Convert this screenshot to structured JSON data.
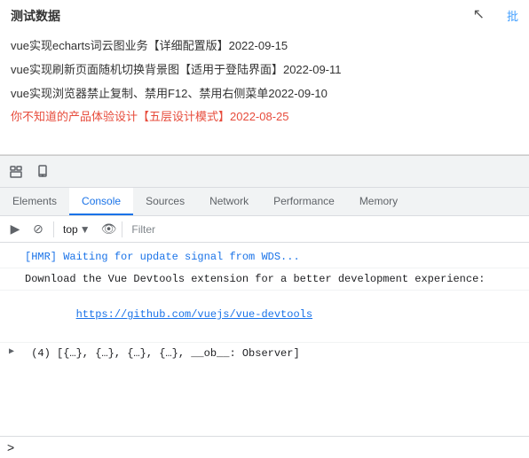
{
  "page": {
    "title": "测试数据",
    "batch_link": "批",
    "cursor_symbol": "↖"
  },
  "articles": [
    {
      "text": "vue实现echarts词云图业务【详细配置版】2022-09-15",
      "red": false
    },
    {
      "text": "vue实现刷新页面随机切换背景图【适用于登陆界面】2022-09-11",
      "red": false
    },
    {
      "text": "vue实现浏览器禁止复制、禁用F12、禁用右侧菜单2022-09-10",
      "red": false
    },
    {
      "text": "你不知道的产品体验设计【五层设计模式】2022-08-25",
      "red": true
    }
  ],
  "devtools": {
    "tabs": [
      {
        "label": "Elements",
        "active": false
      },
      {
        "label": "Console",
        "active": true
      },
      {
        "label": "Sources",
        "active": false
      },
      {
        "label": "Network",
        "active": false
      },
      {
        "label": "Performance",
        "active": false
      },
      {
        "label": "Memory",
        "active": false
      }
    ],
    "console": {
      "context": "top",
      "filter_placeholder": "Filter",
      "messages": [
        {
          "type": "info",
          "text": "[HMR] Waiting for update signal from WDS..."
        },
        {
          "type": "info",
          "text": "Download the Vue Devtools extension for a better development experience:"
        },
        {
          "type": "link",
          "text": "https://github.com/vuejs/vue-devtools"
        },
        {
          "type": "expandable",
          "text": "▶ (4) [{…}, {…}, {…}, {…}, __ob__: Observer]"
        }
      ],
      "prompt_chevron": ">"
    }
  },
  "icons": {
    "cursor": "↖",
    "inspect": "⬚",
    "device": "▭",
    "play": "▶",
    "ban": "⊘",
    "eye": "👁",
    "dropdown": "▼"
  }
}
